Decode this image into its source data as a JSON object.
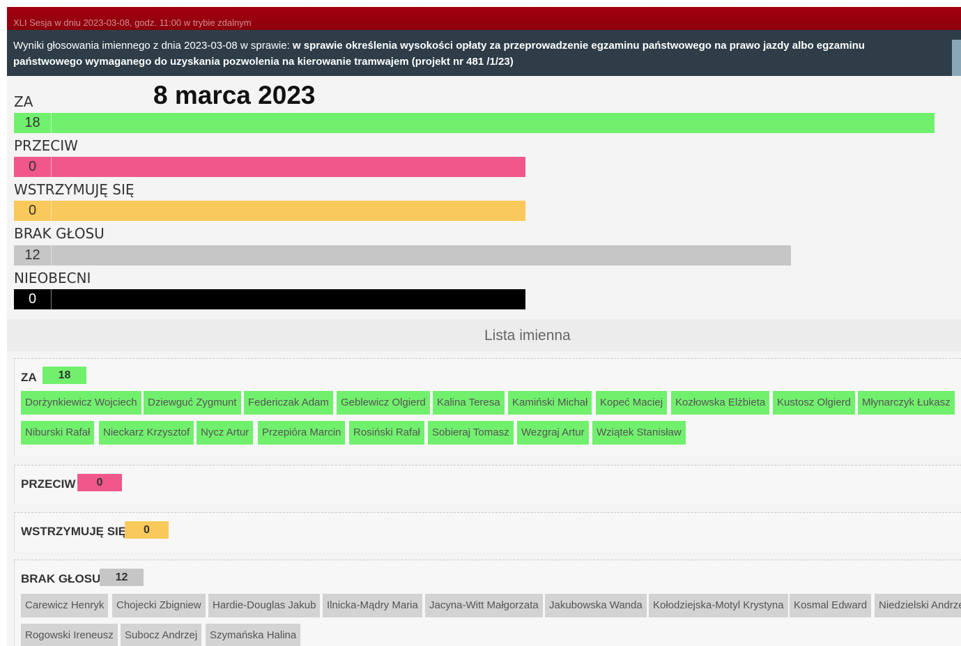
{
  "header": {
    "session": "XLI Sesja w dniu 2023-03-08, godz. 11:00 w trybie zdalnym",
    "results_prefix": "Wyniki głosowania imiennego z dnia 2023-03-08 w sprawie:",
    "results_subject": "w sprawie określenia wysokości opłaty za przeprowadzenie egzaminu państwowego na prawo jazdy albo egzaminu państwowego wymaganego do uzyskania pozwolenia na kierowanie tramwajem (projekt nr 481 /1/23)"
  },
  "overlay_date": "8 marca 2023",
  "summary": [
    {
      "label": "ZA",
      "count": "18",
      "color": "#71f06d"
    },
    {
      "label": "PRZECIW",
      "count": "0",
      "color": "#f0578a"
    },
    {
      "label": "WSTRZYMUJĘ SIĘ",
      "count": "0",
      "color": "#f9c95b"
    },
    {
      "label": "BRAK GŁOSU",
      "count": "12",
      "color": "#c6c6c6"
    },
    {
      "label": "NIEOBECNI",
      "count": "0",
      "color": "#000000"
    }
  ],
  "list_title": "Lista imienna",
  "groups": {
    "za": {
      "label": "ZA",
      "count": "18",
      "color": "#71f06d",
      "names": [
        "Dorżynkiewicz Wojciech",
        "Dziewguć Zygmunt",
        "Federiczak Adam",
        "Geblewicz Olgierd",
        "Kalina Teresa",
        "Kamiński Michał",
        "Kopeć Maciej",
        "Kozłowska Elżbieta",
        "Kustosz Olgierd",
        "Młynarczyk Łukasz",
        "Niburski Rafał",
        "Nieckarz Krzysztof",
        "Nycz Artur",
        "Przepióra Marcin",
        "Rosiński Rafał",
        "Sobieraj Tomasz",
        "Wezgraj Artur",
        "Wziątek Stanisław"
      ]
    },
    "przeciw": {
      "label": "PRZECIW",
      "count": "0",
      "color": "#f0578a"
    },
    "wstrzymuje": {
      "label": "WSTRZYMUJĘ SIĘ",
      "count": "0",
      "color": "#f9c95b"
    },
    "brak": {
      "label": "BRAK GŁOSU",
      "count": "12",
      "color": "#c6c6c6",
      "names": [
        "Carewicz Henryk",
        "Chojecki Zbigniew",
        "Hardie-Douglas Jakub",
        "Ilnicka-Mądry Maria",
        "Jacyna-Witt Małgorzata",
        "Jakubowska Wanda",
        "Kołodziejska-Motyl Krystyna",
        "Kosmal Edward",
        "Niedzielski Andrzej",
        "Rogowski Ireneusz",
        "Subocz Andrzej",
        "Szymańska Halina"
      ]
    }
  }
}
